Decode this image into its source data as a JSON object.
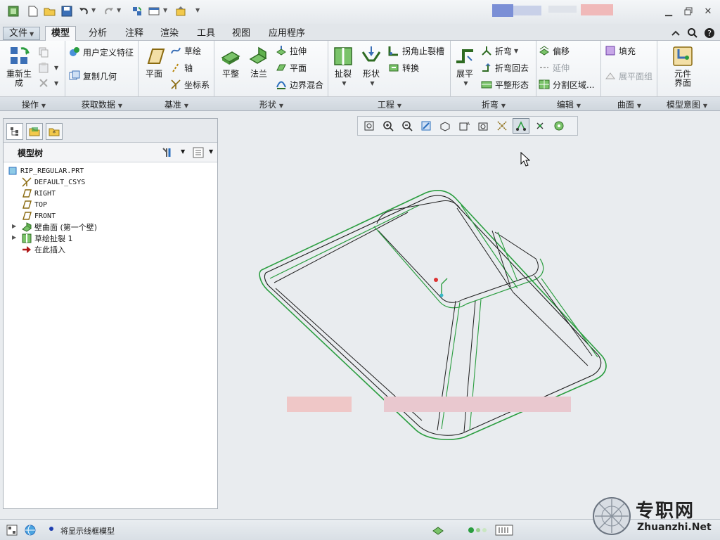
{
  "title_bar": {
    "quick_access_icons": [
      "app-icon",
      "new-icon",
      "open-icon",
      "save-icon",
      "undo-icon",
      "redo-icon",
      "regenerate-icon",
      "window-icon",
      "close-window-icon",
      "customize-icon"
    ],
    "window_controls": [
      "minimize-icon",
      "restore-icon",
      "close-icon"
    ]
  },
  "tabs": [
    {
      "label": "文件",
      "active": false
    },
    {
      "label": "模型",
      "active": true
    },
    {
      "label": "分析",
      "active": false
    },
    {
      "label": "注释",
      "active": false
    },
    {
      "label": "渲染",
      "active": false
    },
    {
      "label": "工具",
      "active": false
    },
    {
      "label": "视图",
      "active": false
    },
    {
      "label": "应用程序",
      "active": false
    }
  ],
  "ribbon": {
    "operations": {
      "regenerate": "重新生成",
      "group": "操作"
    },
    "get_data": {
      "udf": "用户定义特征",
      "copy_geom": "复制几何",
      "group": "获取数据"
    },
    "datum": {
      "plane": "平面",
      "sketch": "草绘",
      "axis": "轴",
      "csys": "坐标系",
      "group": "基准"
    },
    "shapes": {
      "flat": "平整",
      "flange": "法兰",
      "extrude": "拉伸",
      "planar": "平面",
      "blend": "边界混合",
      "group": "形状"
    },
    "engineering": {
      "rip": "扯裂",
      "form": "形状",
      "corner_relief": "拐角止裂槽",
      "convert": "转换",
      "group": "工程"
    },
    "bends": {
      "unbend": "展平",
      "bend": "折弯",
      "bend_back": "折弯回去",
      "flatten": "平整形态",
      "group": "折弯"
    },
    "editing": {
      "offset": "偏移",
      "extend": "延伸",
      "split": "分割区域...",
      "group": "编辑"
    },
    "surfaces": {
      "fill": "填充",
      "flat_pattern": "展平面组",
      "group": "曲面"
    },
    "intent": {
      "component_interface": "元件界面",
      "group": "模型意图"
    }
  },
  "model_tree": {
    "title": "模型树",
    "items": [
      {
        "label": "RIP_REGULAR.PRT",
        "icon": "part-icon",
        "expandable": false
      },
      {
        "label": "DEFAULT_CSYS",
        "icon": "csys-icon",
        "expandable": false
      },
      {
        "label": "RIGHT",
        "icon": "datum-plane-icon",
        "expandable": false
      },
      {
        "label": "TOP",
        "icon": "datum-plane-icon",
        "expandable": false
      },
      {
        "label": "FRONT",
        "icon": "datum-plane-icon",
        "expandable": false
      },
      {
        "label": "壁曲面 (第一个壁)",
        "icon": "wall-icon",
        "expandable": true
      },
      {
        "label": "草绘扯裂 1",
        "icon": "rip-icon",
        "expandable": true
      },
      {
        "label": "在此插入",
        "icon": "insert-arrow-icon",
        "expandable": false
      }
    ]
  },
  "view_toolbar": [
    "refit-icon",
    "zoom-in-icon",
    "zoom-out-icon",
    "repaint-icon",
    "saved-views-icon",
    "named-views-icon",
    "view-manager-icon",
    "display-style-icon",
    "datum-display-icon",
    "spin-center-icon",
    "annotation-display-icon"
  ],
  "status": {
    "message": "将显示线框模型"
  },
  "watermark": {
    "cn": "专职网",
    "en": "Zhuanzhi.Net"
  },
  "colors": {
    "accent_green": "#2a9d3f",
    "edge_dark": "#1e1e1e",
    "ribbon_blue": "#2a6ebd"
  }
}
